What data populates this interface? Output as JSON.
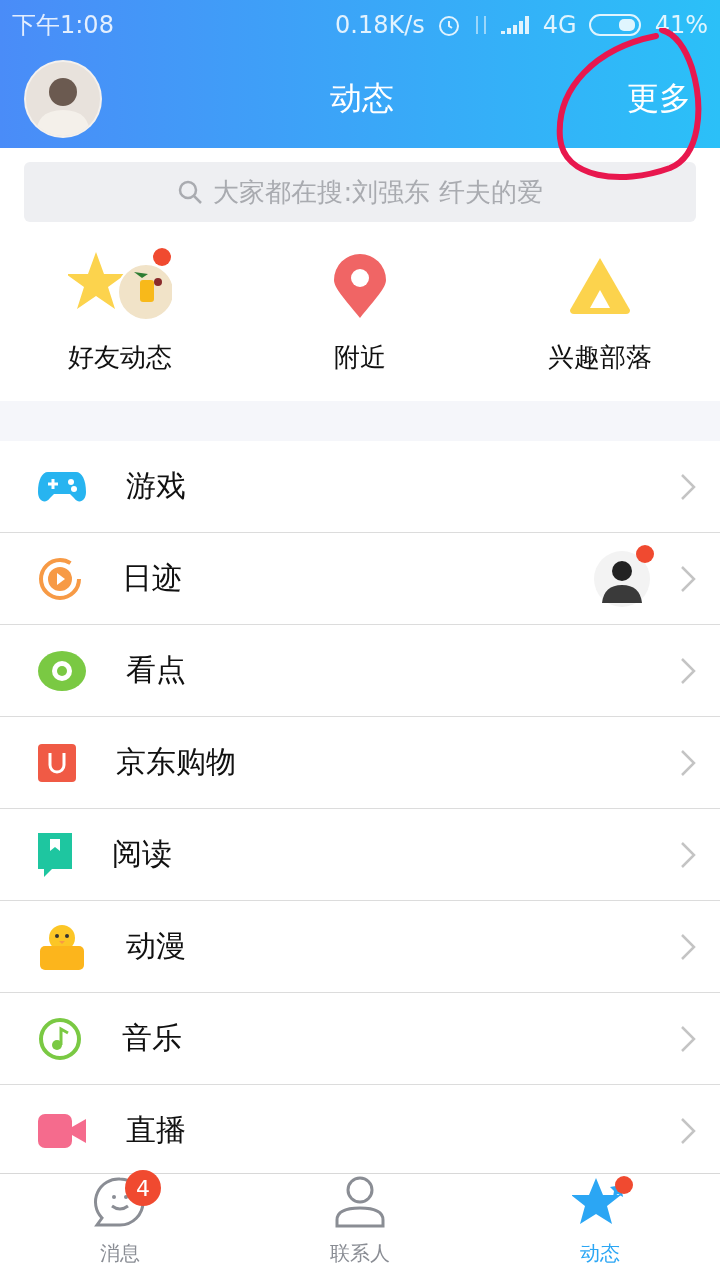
{
  "status_bar": {
    "time": "下午1:08",
    "speed": "0.18K/s",
    "network": "4G",
    "battery": "41%"
  },
  "header": {
    "title": "动态",
    "more": "更多"
  },
  "search": {
    "placeholder": "大家都在搜:刘强东 纤夫的爱"
  },
  "shortcuts": [
    {
      "kind": "friends",
      "label": "好友动态",
      "unread": true
    },
    {
      "kind": "nearby",
      "label": "附近",
      "unread": false
    },
    {
      "kind": "tribe",
      "label": "兴趣部落",
      "unread": false
    }
  ],
  "items": [
    {
      "kind": "game",
      "label": "游戏",
      "unread": false,
      "avatar": false
    },
    {
      "kind": "diary",
      "label": "日迹",
      "unread": true,
      "avatar": true
    },
    {
      "kind": "watch",
      "label": "看点",
      "unread": false,
      "avatar": false
    },
    {
      "kind": "shop",
      "label": "京东购物",
      "unread": false,
      "avatar": false
    },
    {
      "kind": "read",
      "label": "阅读",
      "unread": false,
      "avatar": false
    },
    {
      "kind": "comic",
      "label": "动漫",
      "unread": false,
      "avatar": false
    },
    {
      "kind": "music",
      "label": "音乐",
      "unread": false,
      "avatar": false
    },
    {
      "kind": "live",
      "label": "直播",
      "unread": false,
      "avatar": false
    }
  ],
  "tabs": [
    {
      "kind": "messages",
      "label": "消息",
      "badge": "4",
      "unread": false,
      "selected": false
    },
    {
      "kind": "contacts",
      "label": "联系人",
      "unread": false,
      "selected": false
    },
    {
      "kind": "feed",
      "label": "动态",
      "unread": true,
      "selected": true
    }
  ]
}
